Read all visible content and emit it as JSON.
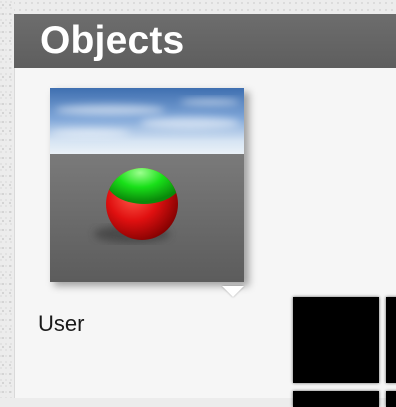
{
  "panel": {
    "title": "Objects"
  },
  "items": [
    {
      "label": "User",
      "preview": "sphere-preview",
      "colors": {
        "sphere_bottom": "#e01010",
        "sphere_top": "#19e019",
        "sky": "#5b88c4",
        "ground": "#676767"
      }
    }
  ],
  "icons": {
    "options_caret": "caret-down-icon"
  }
}
